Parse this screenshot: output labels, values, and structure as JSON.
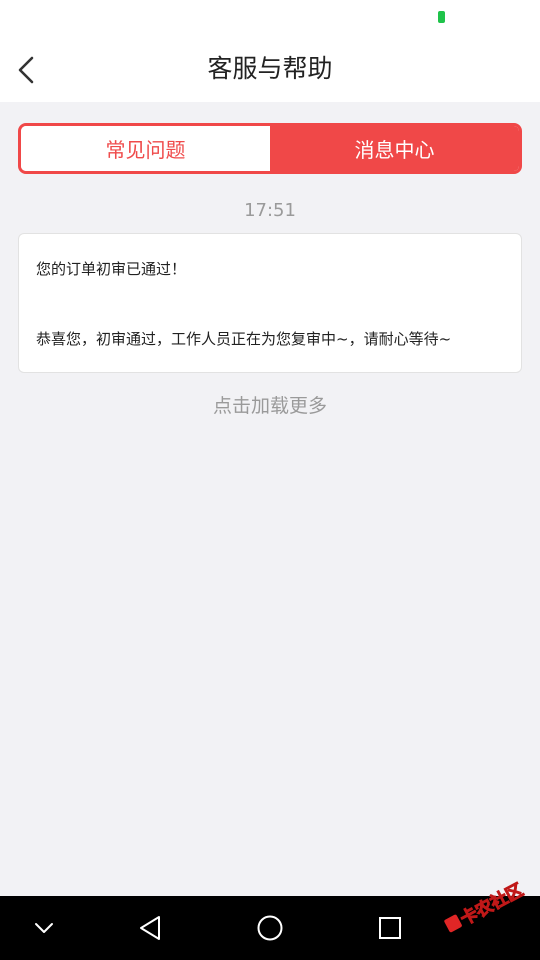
{
  "status_bar": {
    "battery_color": "#1fc34a"
  },
  "header": {
    "title": "客服与帮助",
    "back_icon": "chevron-left-icon"
  },
  "tabs": [
    {
      "label": "常见问题",
      "active": false
    },
    {
      "label": "消息中心",
      "active": true
    }
  ],
  "messages": [
    {
      "time": "17:51",
      "title": "您的订单初审已通过！",
      "body": "恭喜您，初审通过，工作人员正在为您复审中~，请耐心等待~"
    }
  ],
  "load_more": "点击加载更多",
  "nav_bar": {
    "buttons": [
      "chevron-down-icon",
      "back-triangle-icon",
      "home-circle-icon",
      "recents-square-icon"
    ]
  },
  "watermark": {
    "text": "卡农社区"
  },
  "colors": {
    "accent": "#f04848",
    "background": "#f2f2f5",
    "muted_text": "#9a9a9a"
  }
}
